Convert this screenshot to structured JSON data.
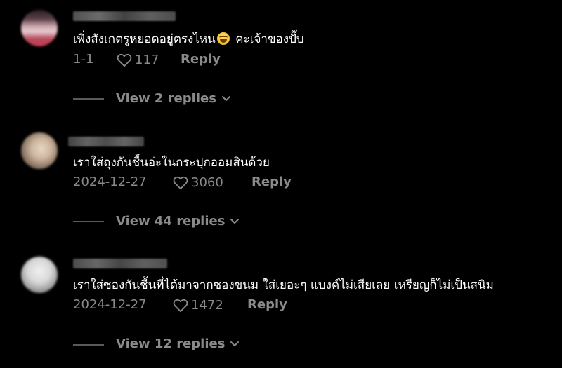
{
  "comments": [
    {
      "text_before_emoji": "เพิ่งสังเกตรูหยอดอยู่ตรงไหน",
      "emoji": "laughing-tears-emoji",
      "text_after_emoji": "คะเจ้าของปั๊บ",
      "date": "1-1",
      "likes": "117",
      "reply_label": "Reply",
      "view_replies_label": "View 2 replies"
    },
    {
      "text": "เราใส่ถุงกันชื้นอ่ะในกระปุกออมสินด้วย",
      "date": "2024-12-27",
      "likes": "3060",
      "reply_label": "Reply",
      "view_replies_label": "View 44 replies"
    },
    {
      "text": "เราใส่ซองกันชื้นที่ได้มาจากซองขนม ใส่เยอะๆ แบงค์ไม่เสียเลย เหรียญก็ไม่เป็นสนิม",
      "date": "2024-12-27",
      "likes": "1472",
      "reply_label": "Reply",
      "view_replies_label": "View 12 replies"
    }
  ],
  "colors": {
    "background": "#000000",
    "primary_text": "#ffffff",
    "secondary_text": "#8a8a8a"
  }
}
